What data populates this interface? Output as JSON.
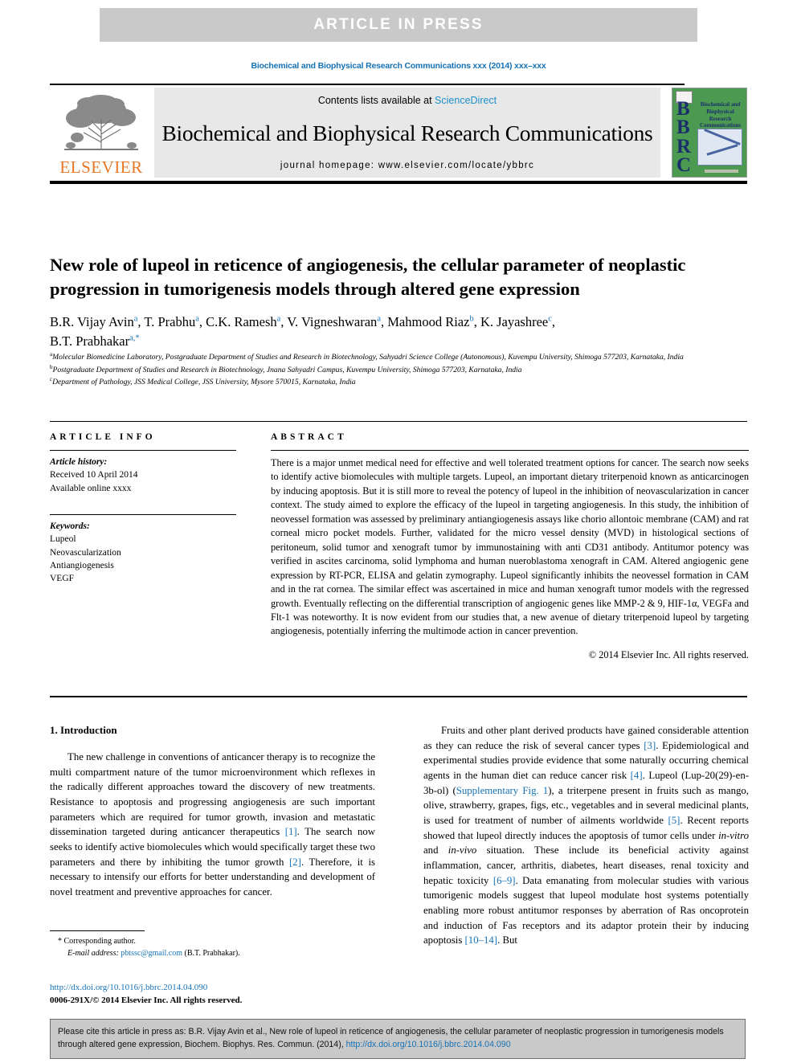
{
  "banner": {
    "label": "ARTICLE  IN  PRESS"
  },
  "running_head": "Biochemical and Biophysical Research Communications xxx (2014) xxx–xxx",
  "masthead": {
    "contents_prefix": "Contents lists available at ",
    "sciencedirect": "ScienceDirect",
    "journal_name": "Biochemical and Biophysical Research Communications",
    "homepage": "journal homepage: www.elsevier.com/locate/ybbrc",
    "publisher_logo_word": "ELSEVIER",
    "cover": {
      "letters": "B\nB\nR\nC",
      "title": "Biochemical and Biophysical Research Communications"
    }
  },
  "article": {
    "title": "New role of lupeol in reticence of angiogenesis, the cellular parameter of neoplastic progression in tumorigenesis models through altered gene expression",
    "authors_line1": "B.R. Vijay Avin a, T. Prabhu a, C.K. Ramesh a, V. Vigneshwaran a, Mahmood Riaz b, K. Jayashree c,",
    "authors_line2": "B.T. Prabhakar a,*",
    "authors": [
      {
        "name": "B.R. Vijay Avin",
        "sup": "a"
      },
      {
        "name": "T. Prabhu",
        "sup": "a"
      },
      {
        "name": "C.K. Ramesh",
        "sup": "a"
      },
      {
        "name": "V. Vigneshwaran",
        "sup": "a"
      },
      {
        "name": "Mahmood Riaz",
        "sup": "b"
      },
      {
        "name": "K. Jayashree",
        "sup": "c"
      },
      {
        "name": "B.T. Prabhakar",
        "sup": "a,*"
      }
    ],
    "affiliations": [
      {
        "mark": "a",
        "text": "Molecular Biomedicine Laboratory, Postgraduate Department of Studies and Research in Biotechnology, Sahyadri Science College (Autonomous), Kuvempu University, Shimoga 577203, Karnataka, India"
      },
      {
        "mark": "b",
        "text": "Postgraduate Department of Studies and Research in Biotechnology, Jnana Sahyadri Campus, Kuvempu University, Shimoga 577203, Karnataka, India"
      },
      {
        "mark": "c",
        "text": "Department of Pathology, JSS Medical College, JSS University, Mysore 570015, Karnataka, India"
      }
    ]
  },
  "article_info": {
    "heading": "ARTICLE INFO",
    "history_label": "Article history:",
    "history_lines": [
      "Received 10 April 2014",
      "Available online xxxx"
    ],
    "keywords_label": "Keywords:",
    "keywords": [
      "Lupeol",
      "Neovascularization",
      "Antiangiogenesis",
      "VEGF"
    ]
  },
  "abstract": {
    "heading": "ABSTRACT",
    "text": "There is a major unmet medical need for effective and well tolerated treatment options for cancer. The search now seeks to identify active biomolecules with multiple targets. Lupeol, an important dietary triterpenoid known as anticarcinogen by inducing apoptosis. But it is still more to reveal the potency of lupeol in the inhibition of neovascularization in cancer context. The study aimed to explore the efficacy of the lupeol in targeting angiogenesis. In this study, the inhibition of neovessel formation was assessed by preliminary antiangiogenesis assays like chorio allontoic membrane (CAM) and rat corneal micro pocket models. Further, validated for the micro vessel density (MVD) in histological sections of peritoneum, solid tumor and xenograft tumor by immunostaining with anti CD31 antibody. Antitumor potency was verified in ascites carcinoma, solid lymphoma and human nueroblastoma xenograft in CAM. Altered angiogenic gene expression by RT-PCR, ELISA and gelatin zymography. Lupeol significantly inhibits the neovessel formation in CAM and in the rat cornea. The similar effect was ascertained in mice and human xenograft tumor models with the regressed growth. Eventually reflecting on the differential transcription of angiogenic genes like MMP-2 & 9, HIF-1α, VEGFa and Flt-1 was noteworthy. It is now evident from our studies that, a new avenue of dietary triterpenoid lupeol by targeting angiogenesis, potentially inferring the multimode action in cancer prevention.",
    "copyright": "© 2014 Elsevier Inc. All rights reserved."
  },
  "introduction": {
    "section_title": "1. Introduction",
    "left_para": "The new challenge in conventions of anticancer therapy is to recognize the multi compartment nature of the tumor microenvironment which reflexes in the radically different approaches toward the discovery of new treatments. Resistance to apoptosis and progressing angiogenesis are such important parameters which are required for tumor growth, invasion and metastatic dissemination targeted during anticancer therapeutics [1]. The search now seeks to identify active biomolecules which would specifically target these two parameters and there by inhibiting the tumor growth [2]. Therefore, it is necessary to intensify our efforts for better understanding and development of novel treatment and preventive approaches for cancer.",
    "right_para": "Fruits and other plant derived products have gained considerable attention as they can reduce the risk of several cancer types [3]. Epidemiological and experimental studies provide evidence that some naturally occurring chemical agents in the human diet can reduce cancer risk [4]. Lupeol (Lup-20(29)-en-3b-ol) (Supplementary Fig. 1), a triterpene present in fruits such as mango, olive, strawberry, grapes, figs, etc., vegetables and in several medicinal plants, is used for treatment of number of ailments worldwide [5]. Recent reports showed that lupeol directly induces the apoptosis of tumor cells under in-vitro and in-vivo situation. These include its beneficial activity against inflammation, cancer, arthritis, diabetes, heart diseases, renal toxicity and hepatic toxicity [6–9]. Data emanating from molecular studies with various tumorigenic models suggest that lupeol modulate host systems potentially enabling more robust antitumor responses by aberration of Ras oncoprotein and induction of Fas receptors and its adaptor protein their by inducing apoptosis [10–14]. But"
  },
  "footnote": {
    "corresponding_mark": "*",
    "corresponding_label": "Corresponding author.",
    "email_label": "E-mail address:",
    "email": "pbtssc@gmail.com",
    "email_owner": "(B.T. Prabhakar)."
  },
  "footer": {
    "doi": "http://dx.doi.org/10.1016/j.bbrc.2014.04.090",
    "issn_line": "0006-291X/© 2014 Elsevier Inc. All rights reserved."
  },
  "cite_box": {
    "text_before_doi": "Please cite this article in press as: B.R. Vijay Avin et al., New role of lupeol in reticence of angiogenesis, the cellular parameter of neoplastic progression in tumorigenesis models through altered gene expression, Biochem. Biophys. Res. Commun. (2014), ",
    "doi": "http://dx.doi.org/10.1016/j.bbrc.2014.04.090"
  },
  "colors": {
    "link_blue": "#1672b5",
    "sciencedirect_blue": "#1d8fc9",
    "elsevier_orange": "#e87722",
    "banner_gray": "#c9c9c9",
    "journal_block_gray": "#e8e8e8",
    "cover_green": "#4c9a52"
  }
}
